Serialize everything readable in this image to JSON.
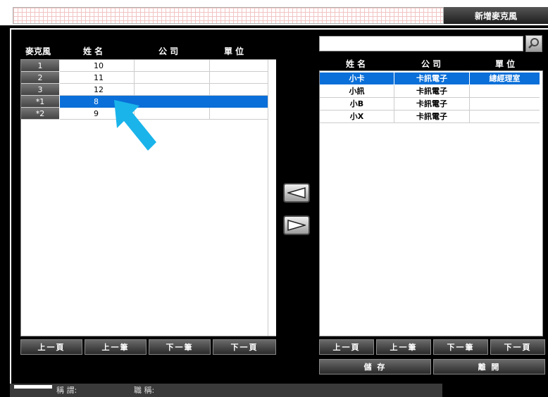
{
  "window": {
    "title": "新增麥克風"
  },
  "left_table": {
    "headers": [
      "麥克風",
      "姓 名",
      "公 司",
      "單 位"
    ],
    "rows": [
      {
        "mic": "1",
        "name": "10",
        "company": "",
        "unit": "",
        "selected": false
      },
      {
        "mic": "2",
        "name": "11",
        "company": "",
        "unit": "",
        "selected": false
      },
      {
        "mic": "3",
        "name": "12",
        "company": "",
        "unit": "",
        "selected": false
      },
      {
        "mic": "*1",
        "name": "8",
        "company": "",
        "unit": "",
        "selected": true
      },
      {
        "mic": "*2",
        "name": "9",
        "company": "",
        "unit": "",
        "selected": false
      }
    ]
  },
  "right_table": {
    "search_value": "",
    "headers": [
      "姓 名",
      "公 司",
      "單 位"
    ],
    "rows": [
      {
        "name": "小卡",
        "company": "卡訊電子",
        "unit": "總經理室",
        "selected": true
      },
      {
        "name": "小訊",
        "company": "卡訊電子",
        "unit": "",
        "selected": false
      },
      {
        "name": "小B",
        "company": "卡訊電子",
        "unit": "",
        "selected": false
      },
      {
        "name": "小X",
        "company": "卡訊電子",
        "unit": "",
        "selected": false
      }
    ]
  },
  "left_nav": {
    "first": "上一頁",
    "prev": "上一筆",
    "next": "下一筆",
    "last": "下一頁"
  },
  "right_nav": {
    "first": "上一頁",
    "prev": "上一筆",
    "next": "下一筆",
    "last": "下一頁"
  },
  "actions": {
    "save": "儲 存",
    "leave": "離 開"
  },
  "status": {
    "title_label": "稱 謂:",
    "position_label": "職 稱:"
  },
  "icons": {
    "search": "search-icon",
    "move_left": "triangle-left-icon",
    "move_right": "triangle-right-icon",
    "pointer": "arrow-pointer-icon"
  },
  "colors": {
    "selection": "#0a6fd8",
    "pointer": "#1ab4ea"
  }
}
